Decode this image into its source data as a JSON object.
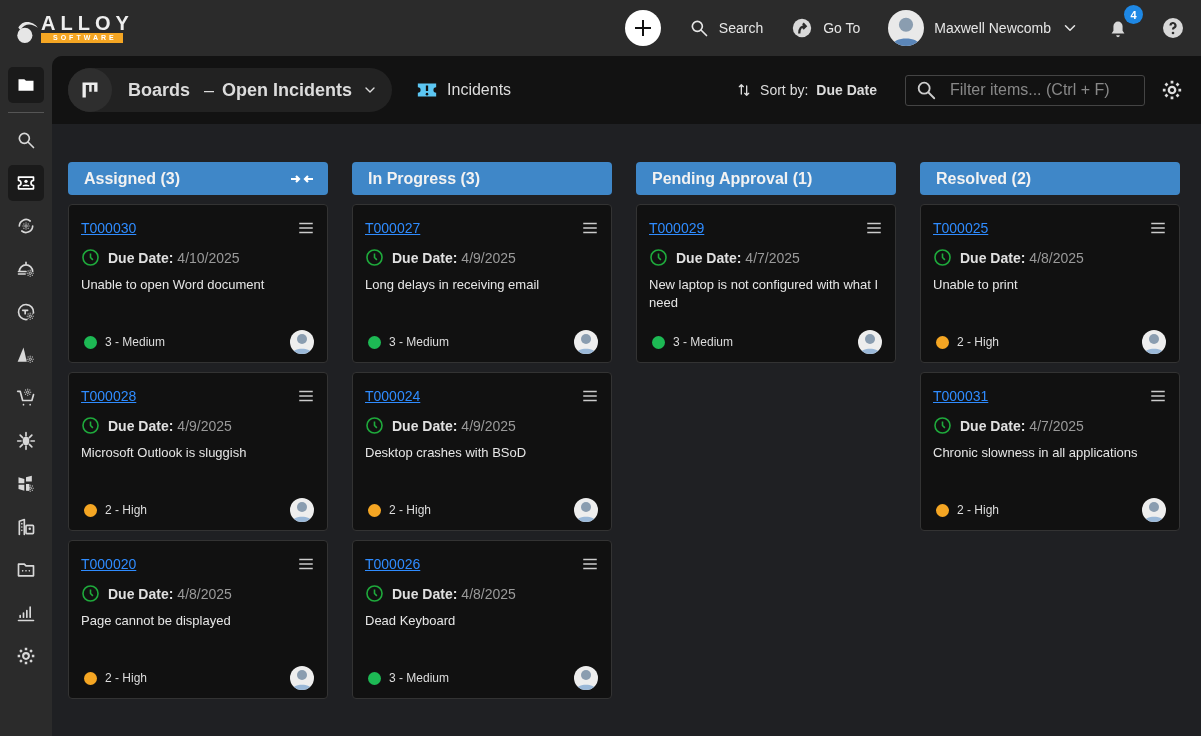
{
  "logo": {
    "name": "ALLOY",
    "tagline": "SOFTWARE"
  },
  "top_bar": {
    "search": "Search",
    "go_to": "Go To",
    "user": "Maxwell Newcomb",
    "notifications": "4"
  },
  "sidebar": {
    "items": [
      {
        "selected": true
      },
      {
        "selected": false
      },
      {
        "selected": true
      },
      {
        "selected": false
      },
      {
        "selected": false
      },
      {
        "selected": false
      },
      {
        "selected": false
      },
      {
        "selected": false
      },
      {
        "selected": false
      },
      {
        "selected": false
      },
      {
        "selected": false
      },
      {
        "selected": false
      },
      {
        "selected": false
      },
      {
        "selected": false
      }
    ]
  },
  "toolbar": {
    "board": "Boards",
    "separator": "–",
    "view": "Open Incidents",
    "object": "Incidents",
    "sort_label": "Sort by:",
    "sort_value": "Due Date",
    "filter_placeholder": "Filter items... (Ctrl + F)"
  },
  "columns": [
    {
      "title": "Assigned (3)",
      "collapse_control": true,
      "cards": [
        {
          "id": "T000030",
          "due_label": "Due Date:",
          "due": "4/10/2025",
          "summary": "Unable to open Word document",
          "priority": "3 - Medium",
          "color": "#1db954"
        },
        {
          "id": "T000028",
          "due_label": "Due Date:",
          "due": "4/9/2025",
          "summary": "Microsoft Outlook is sluggish",
          "priority": "2 - High",
          "color": "#f5a623"
        },
        {
          "id": "T000020",
          "due_label": "Due Date:",
          "due": "4/8/2025",
          "summary": "Page cannot be displayed",
          "priority": "2 - High",
          "color": "#f5a623"
        }
      ]
    },
    {
      "title": "In Progress (3)",
      "collapse_control": false,
      "cards": [
        {
          "id": "T000027",
          "due_label": "Due Date:",
          "due": "4/9/2025",
          "summary": "Long delays in receiving email",
          "priority": "3 - Medium",
          "color": "#1db954"
        },
        {
          "id": "T000024",
          "due_label": "Due Date:",
          "due": "4/9/2025",
          "summary": "Desktop crashes with BSoD",
          "priority": "2 - High",
          "color": "#f5a623"
        },
        {
          "id": "T000026",
          "due_label": "Due Date:",
          "due": "4/8/2025",
          "summary": "Dead Keyboard",
          "priority": "3 - Medium",
          "color": "#1db954"
        }
      ]
    },
    {
      "title": "Pending Approval (1)",
      "collapse_control": false,
      "cards": [
        {
          "id": "T000029",
          "due_label": "Due Date:",
          "due": "4/7/2025",
          "summary": "New laptop is not configured with what I need",
          "priority": "3 - Medium",
          "color": "#1db954"
        }
      ]
    },
    {
      "title": "Resolved (2)",
      "collapse_control": false,
      "cards": [
        {
          "id": "T000025",
          "due_label": "Due Date:",
          "due": "4/8/2025",
          "summary": "Unable to print",
          "priority": "2 - High",
          "color": "#f5a623"
        },
        {
          "id": "T000031",
          "due_label": "Due Date:",
          "due": "4/7/2025",
          "summary": "Chronic slowness in all applications",
          "priority": "2 - High",
          "color": "#f5a623"
        }
      ]
    }
  ]
}
